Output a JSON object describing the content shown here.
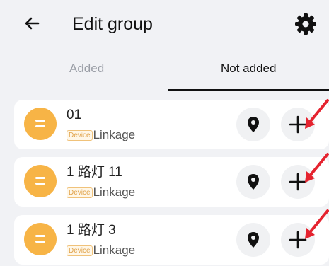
{
  "header": {
    "title": "Edit group",
    "back_icon": "arrow-left-icon",
    "settings_icon": "gear-icon"
  },
  "tabs": [
    {
      "label": "Added",
      "active": false
    },
    {
      "label": "Not added",
      "active": true
    }
  ],
  "devices": [
    {
      "name": "01",
      "tag": "Device",
      "subtitle": "Linkage"
    },
    {
      "name": "1 路灯 11",
      "tag": "Device",
      "subtitle": "Linkage"
    },
    {
      "name": "1 路灯 3",
      "tag": "Device",
      "subtitle": "Linkage"
    }
  ],
  "icons": {
    "device": "bulb-icon",
    "locate": "location-pin-icon",
    "add": "plus-icon",
    "annotation": "red-arrow-icon"
  },
  "colors": {
    "background": "#f1f2f5",
    "bulb": "#f7b446",
    "annotation_arrow": "#e5232f",
    "active_tab": "#111111",
    "inactive_tab": "#9a9ea6"
  }
}
